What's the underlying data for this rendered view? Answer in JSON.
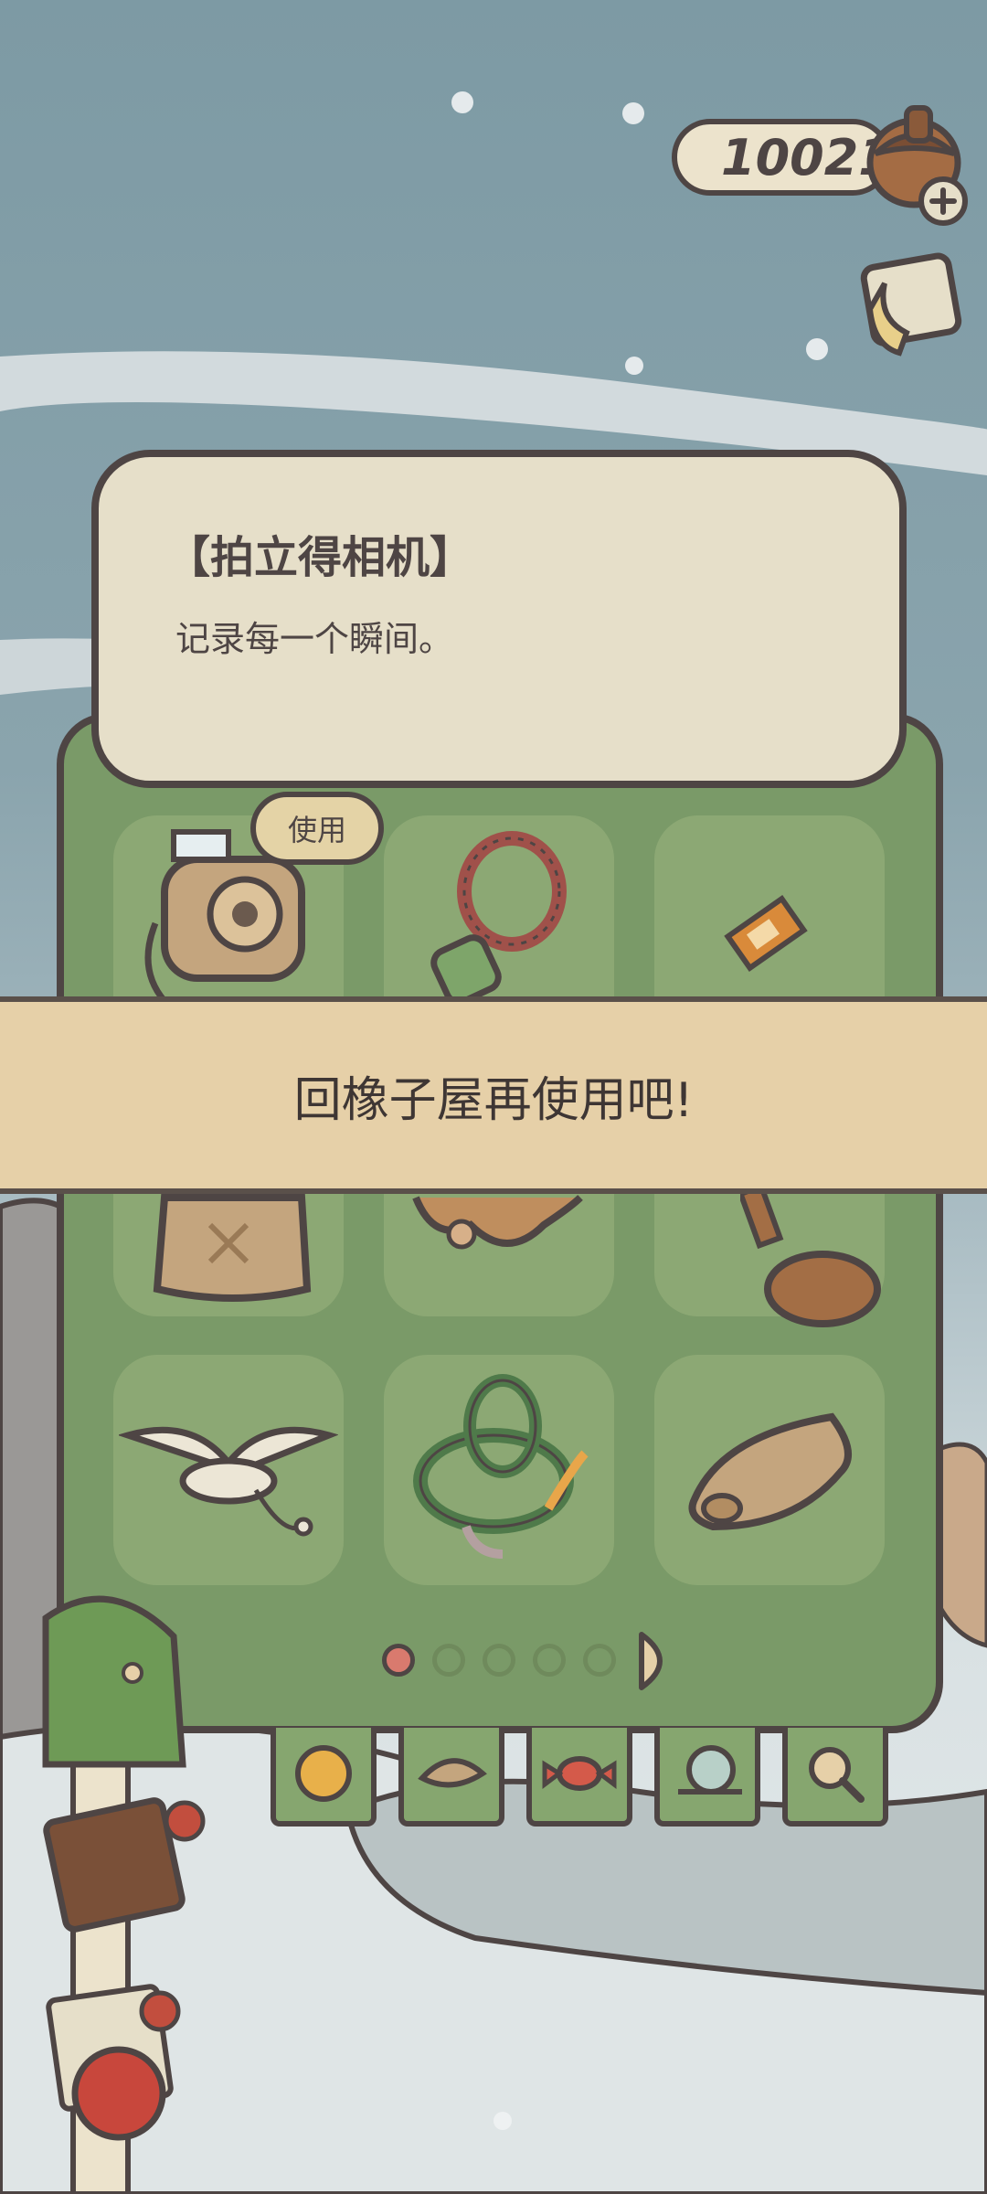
{
  "hud": {
    "acorn_count": "10021"
  },
  "item_info": {
    "title": "【拍立得相机】",
    "description": "记录每一个瞬间。"
  },
  "use_button": {
    "label": "使用"
  },
  "toast": {
    "message": "回橡子屋再使用吧!"
  },
  "pagination": {
    "total_pages": 5,
    "current_page": 1
  },
  "inventory_items": [
    "instant-camera",
    "beaded-bell-charm",
    "ticket",
    "embroidered-bag",
    "gear-ornament",
    "wooden-oar",
    "seagull-toy",
    "coiled-rope",
    "rolled-map"
  ],
  "tabs": [
    "yarn-ball-tab",
    "leaf-tab",
    "candy-tab",
    "snail-tab",
    "magnifier-tab"
  ],
  "colors": {
    "panel_green": "#7a9a68",
    "card_cream": "#e6dfc9",
    "toast_tan": "#e6d0a8",
    "outline": "#4e4544"
  }
}
